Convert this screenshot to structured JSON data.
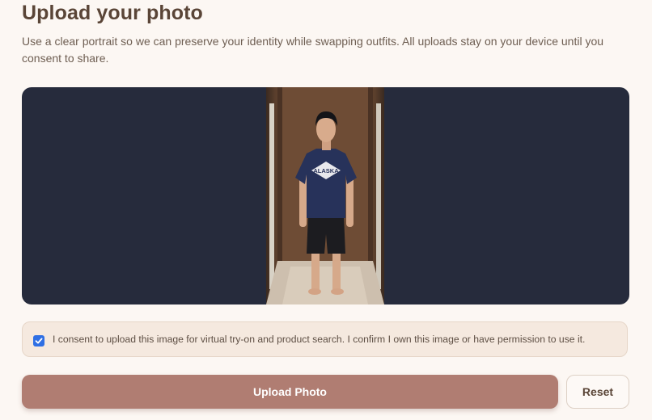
{
  "header": {
    "title": "Upload your photo",
    "subtitle": "Use a clear portrait so we can preserve your identity while swapping outfits. All uploads stay on your device until you consent to share."
  },
  "preview": {
    "shirt_text": "ALASKA"
  },
  "consent": {
    "checked": true,
    "label": "I consent to upload this image for virtual try-on and product search. I confirm I own this image or have permission to use it."
  },
  "actions": {
    "upload_label": "Upload Photo",
    "reset_label": "Reset"
  },
  "colors": {
    "background": "#fcf7f3",
    "preview_bg": "#262b3c",
    "primary_button": "#b07d72",
    "checkbox": "#2f6fe4"
  }
}
